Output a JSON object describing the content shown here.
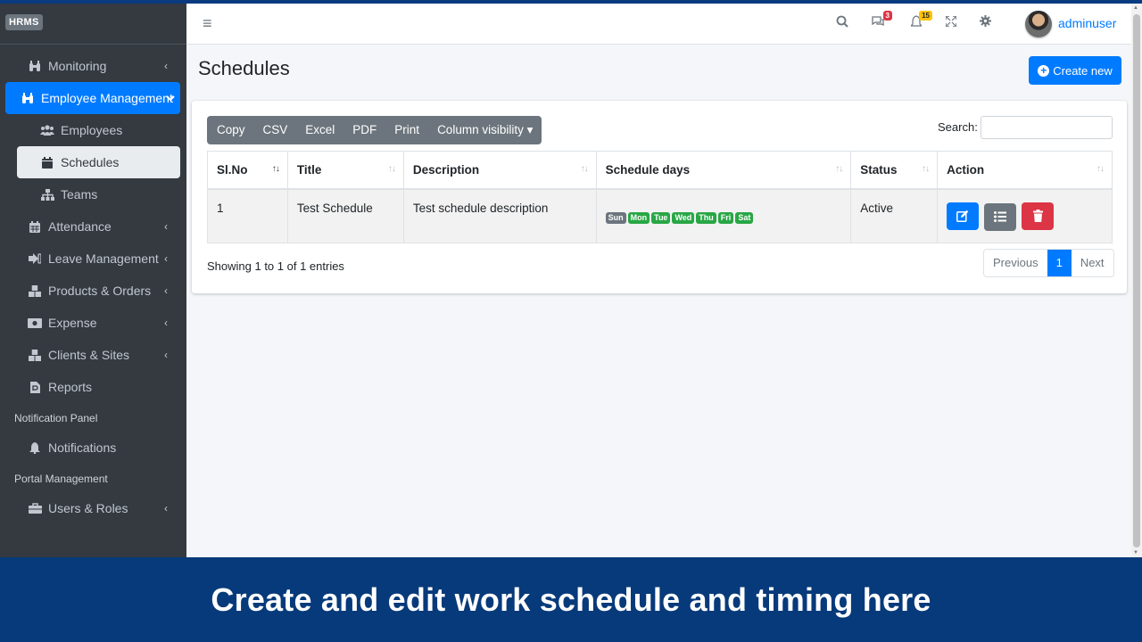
{
  "brand": {
    "logo": "HRMS"
  },
  "sidebar": {
    "items": [
      {
        "label": "Monitoring",
        "icon": "binoculars-icon"
      },
      {
        "label": "Employee Management",
        "icon": "binoculars-icon"
      },
      {
        "label": "Employees",
        "icon": "users-icon"
      },
      {
        "label": "Schedules",
        "icon": "calendar-icon"
      },
      {
        "label": "Teams",
        "icon": "sitemap-icon"
      },
      {
        "label": "Attendance",
        "icon": "calendar-grid-icon"
      },
      {
        "label": "Leave Management",
        "icon": "sign-out-icon"
      },
      {
        "label": "Products & Orders",
        "icon": "boxes-icon"
      },
      {
        "label": "Expense",
        "icon": "money-icon"
      },
      {
        "label": "Clients & Sites",
        "icon": "boxes-icon"
      },
      {
        "label": "Reports",
        "icon": "file-icon"
      }
    ],
    "header_notification": "Notification Panel",
    "notifications": "Notifications",
    "header_portal": "Portal Management",
    "users_roles": "Users & Roles"
  },
  "topbar": {
    "messages_badge": "3",
    "notifications_badge": "15",
    "username": "adminuser"
  },
  "page": {
    "title": "Schedules",
    "create_label": "Create new"
  },
  "table_tools": {
    "buttons": [
      "Copy",
      "CSV",
      "Excel",
      "PDF",
      "Print",
      "Column visibility ▾"
    ],
    "search_label": "Search:"
  },
  "table": {
    "headers": [
      "Sl.No",
      "Title",
      "Description",
      "Schedule days",
      "Status",
      "Action"
    ],
    "rows": [
      {
        "slno": "1",
        "title": "Test Schedule",
        "description": "Test schedule description",
        "status": "Active"
      }
    ],
    "days": [
      {
        "label": "Sun",
        "color": "#6c757d"
      },
      {
        "label": "Mon",
        "color": "#28a745"
      },
      {
        "label": "Tue",
        "color": "#28a745"
      },
      {
        "label": "Wed",
        "color": "#28a745"
      },
      {
        "label": "Thu",
        "color": "#28a745"
      },
      {
        "label": "Fri",
        "color": "#28a745"
      },
      {
        "label": "Sat",
        "color": "#28a745"
      }
    ]
  },
  "footer": {
    "info": "Showing 1 to 1 of 1 entries",
    "previous": "Previous",
    "page": "1",
    "next": "Next"
  },
  "caption": "Create and edit work schedule and timing here",
  "colors": {
    "primary": "#007bff",
    "sidebar": "#343a40",
    "danger": "#dc3545",
    "secondary": "#6c757d",
    "caption_bg": "#073a7a"
  }
}
